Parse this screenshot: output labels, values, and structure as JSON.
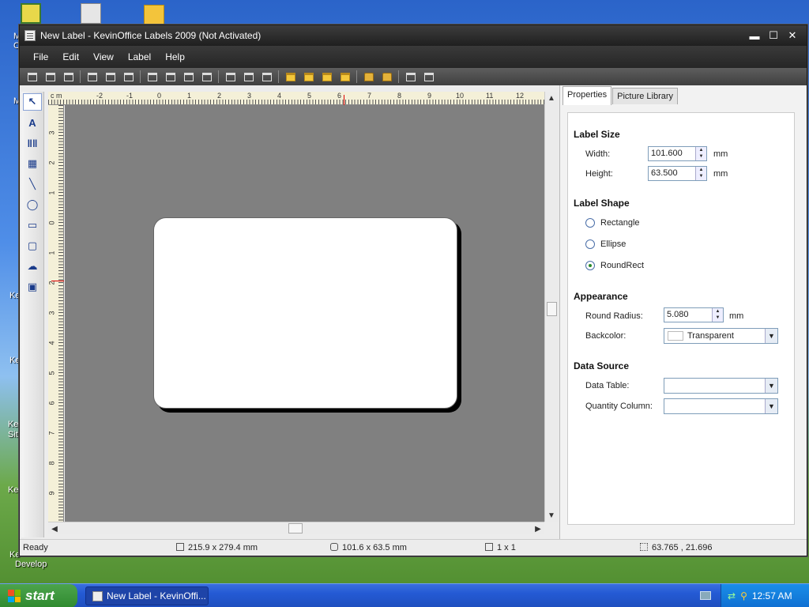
{
  "desktop": {
    "labels": [
      "M",
      "C",
      "M",
      "Ke",
      "Ke",
      "Ke",
      "Sit",
      "Ke",
      "Ke",
      "Develop"
    ]
  },
  "window": {
    "title": "New Label - KevinOffice Labels 2009 (Not Activated)",
    "minimize": "▬",
    "maximize": "☐",
    "close": "✕"
  },
  "menu": [
    "File",
    "Edit",
    "View",
    "Label",
    "Help"
  ],
  "ruler": {
    "unit": "c m",
    "h_labels": [
      "-2",
      "-1",
      "0",
      "1",
      "2",
      "3",
      "4",
      "5",
      "6",
      "7",
      "8",
      "9",
      "10",
      "11",
      "12"
    ],
    "v_labels": [
      "3",
      "2",
      "1",
      "0",
      "1",
      "2",
      "3",
      "4",
      "5",
      "6",
      "7",
      "8",
      "9"
    ]
  },
  "properties": {
    "tabs": [
      "Properties",
      "Picture Library"
    ],
    "label_size": {
      "heading": "Label Size",
      "width_label": "Width:",
      "width_value": "101.600",
      "height_label": "Height:",
      "height_value": "63.500",
      "unit": "mm"
    },
    "label_shape": {
      "heading": "Label Shape",
      "options": [
        "Rectangle",
        "Ellipse",
        "RoundRect"
      ],
      "selected": "RoundRect"
    },
    "appearance": {
      "heading": "Appearance",
      "radius_label": "Round Radius:",
      "radius_value": "5.080",
      "unit": "mm",
      "backcolor_label": "Backcolor:",
      "backcolor_value": "Transparent"
    },
    "data_source": {
      "heading": "Data Source",
      "table_label": "Data Table:",
      "table_value": "",
      "quantity_label": "Quantity Column:",
      "quantity_value": ""
    }
  },
  "status": {
    "ready": "Ready",
    "page_size": "215.9 x 279.4 mm",
    "label_size": "101.6 x 63.5 mm",
    "grid": "1 x 1",
    "coords": "63.765 , 21.696"
  },
  "taskbar": {
    "start": "start",
    "task": "New Label - KevinOffi...",
    "clock": "12:57 AM"
  }
}
